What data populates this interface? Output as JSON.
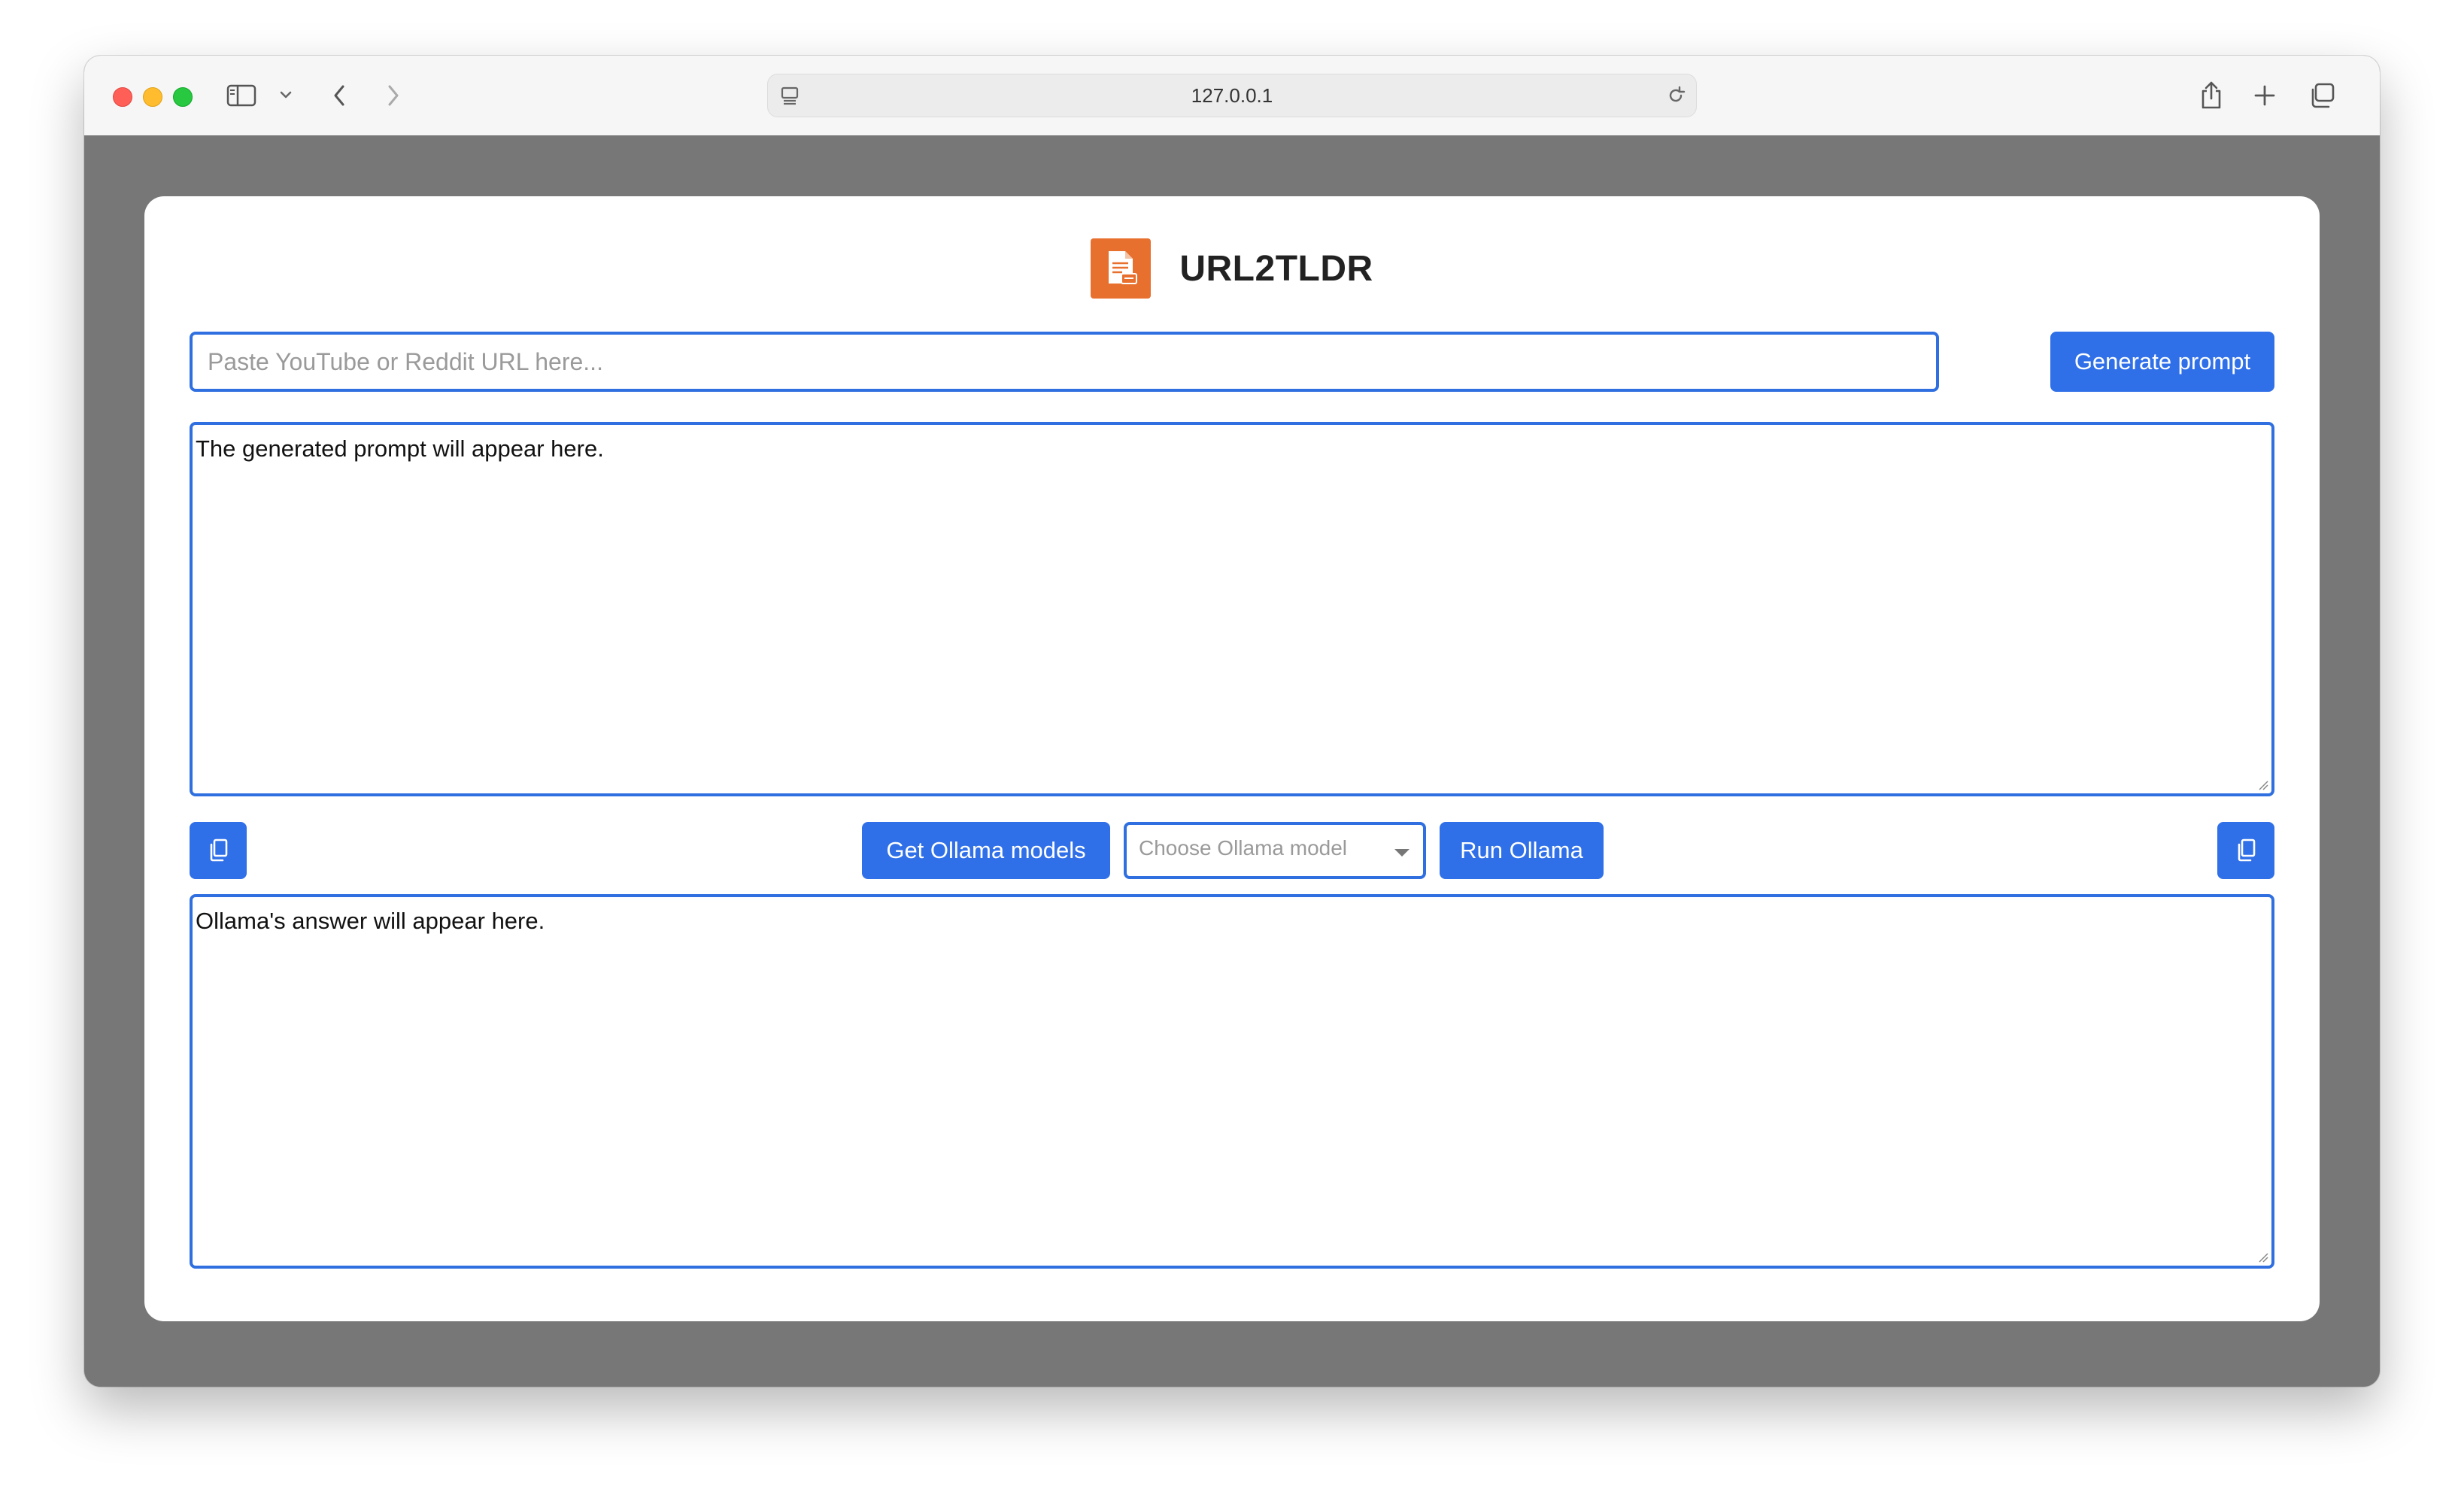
{
  "browser": {
    "address": "127.0.0.1",
    "icons": {
      "sidebar": "sidebar-icon",
      "sidebar_menu": "chevron-down-icon",
      "back": "chevron-left-icon",
      "forward": "chevron-right-icon",
      "site": "site-settings-icon",
      "reload": "reload-icon",
      "share": "share-icon",
      "new_tab": "plus-icon",
      "tabs": "tab-overview-icon"
    }
  },
  "app": {
    "title": "URL2TLDR",
    "logo_icon": "document-icon",
    "url_input": {
      "placeholder": "Paste YouTube or Reddit URL here...",
      "value": ""
    },
    "generate_button": "Generate prompt",
    "prompt_output": "The generated prompt will appear here.",
    "copy_icon": "copy-icon",
    "get_models_button": "Get Ollama models",
    "model_select": {
      "placeholder": "Choose Ollama model"
    },
    "run_button": "Run Ollama",
    "answer_output": "Ollama's answer will appear here."
  },
  "colors": {
    "accent": "#2f6fe8",
    "logo": "#e8702f",
    "backdrop": "#777777"
  }
}
